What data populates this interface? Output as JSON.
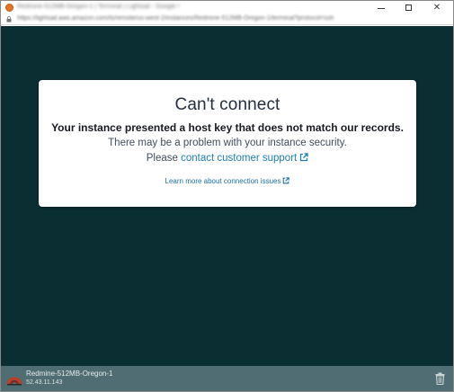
{
  "window": {
    "title": "Redmine-512MB-Oregon-1 | Terminal | Lightsail - Google Chrome",
    "url": "https://lightsail.aws.amazon.com/ls/remote/us-west-2/instances/Redmine-512MB-Oregon-1/terminal?protocol=ssh",
    "minimize_icon": "minimize-icon",
    "maximize_icon": "maximize-icon",
    "close_glyph": "✕"
  },
  "dialog": {
    "title": "Can't connect",
    "message": "Your instance presented a host key that does not match our records.",
    "sub_message": "There may be a problem with your instance security.",
    "please_prefix": "Please ",
    "support_link": "contact customer support",
    "learn_more_link": "Learn more about connection issues"
  },
  "footer": {
    "instance_name": "Redmine-512MB-Oregon-1",
    "ip_address": "52.43.11.143",
    "instance_icon": "redmine-icon",
    "trash_icon": "trash-icon"
  },
  "colors": {
    "terminal_bg": "#0b2e33",
    "footer_bg": "#4f6d72",
    "link": "#1c7eb0",
    "app_icon": "#e8741c"
  }
}
